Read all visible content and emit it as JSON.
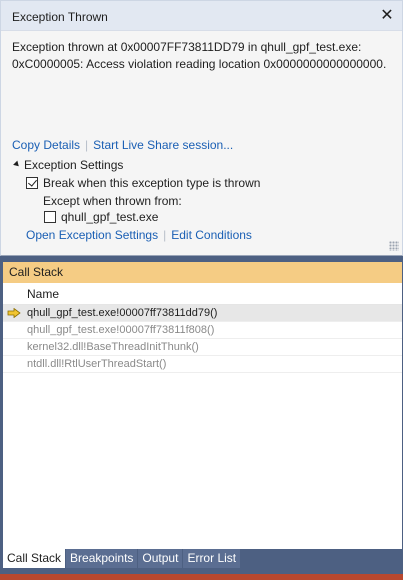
{
  "exception": {
    "title": "Exception Thrown",
    "message_line1": "Exception thrown at 0x00007FF73811DD79 in qhull_gpf_test.exe:",
    "message_line2": "0xC0000005: Access violation reading location 0x0000000000000000.",
    "copy_details": "Copy Details",
    "live_share": "Start Live Share session...",
    "settings_header": "Exception Settings",
    "break_when_label": "Break when this exception type is thrown",
    "break_when_checked": true,
    "except_when": "Except when thrown from:",
    "module_label": "qhull_gpf_test.exe",
    "module_checked": false,
    "open_settings": "Open Exception Settings",
    "edit_conditions": "Edit Conditions"
  },
  "call_stack": {
    "title": "Call Stack",
    "column_name": "Name",
    "rows": [
      "qhull_gpf_test.exe!00007ff73811dd79()",
      "qhull_gpf_test.exe!00007ff73811f808()",
      "kernel32.dll!BaseThreadInitThunk()",
      "ntdll.dll!RtlUserThreadStart()"
    ]
  },
  "tabs": [
    "Call Stack",
    "Breakpoints",
    "Output",
    "Error List"
  ],
  "colors": {
    "panel_title_bg": "#f5cc84",
    "link": "#1a5fb4",
    "current_frame_arrow": "#f2c531",
    "background": "#4d6082"
  }
}
